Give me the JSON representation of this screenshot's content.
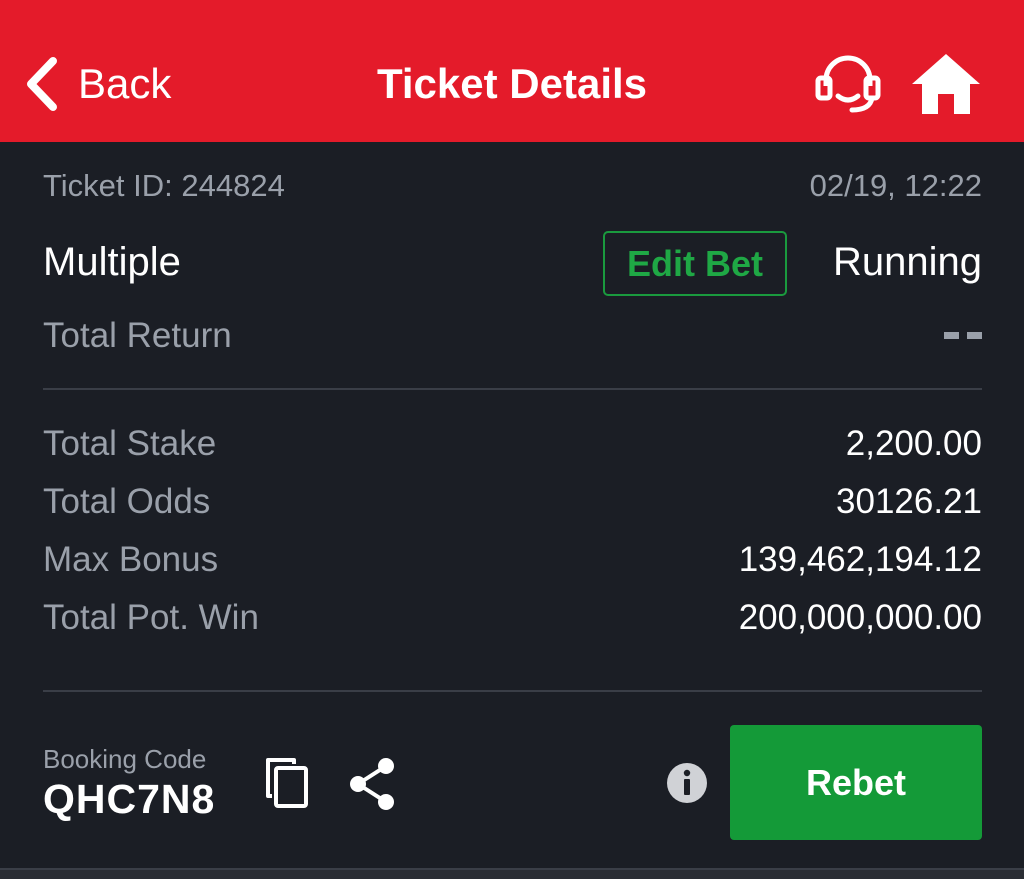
{
  "header": {
    "back_label": "Back",
    "title": "Ticket Details",
    "icons": [
      "chevron-left-icon",
      "headset-icon",
      "home-icon"
    ]
  },
  "ticket": {
    "id_label": "Ticket ID: 244824",
    "datetime": "02/19, 12:22",
    "type": "Multiple",
    "edit_bet_label": "Edit Bet",
    "status": "Running",
    "total_return_label": "Total Return",
    "total_return_value": "--"
  },
  "summary": [
    {
      "label": "Total Stake",
      "value": "2,200.00"
    },
    {
      "label": "Total Odds",
      "value": "30126.21"
    },
    {
      "label": "Max Bonus",
      "value": "139,462,194.12"
    },
    {
      "label": "Total Pot. Win",
      "value": "200,000,000.00"
    }
  ],
  "booking": {
    "label": "Booking Code",
    "code": "QHC7N8",
    "icons": [
      "copy-icon",
      "share-icon",
      "info-icon"
    ]
  },
  "actions": {
    "rebet_label": "Rebet"
  },
  "colors": {
    "header_bg": "#e41b2a",
    "body_bg": "#1b1e25",
    "accent_green": "#149a38",
    "muted_text": "#9aa0aa"
  }
}
